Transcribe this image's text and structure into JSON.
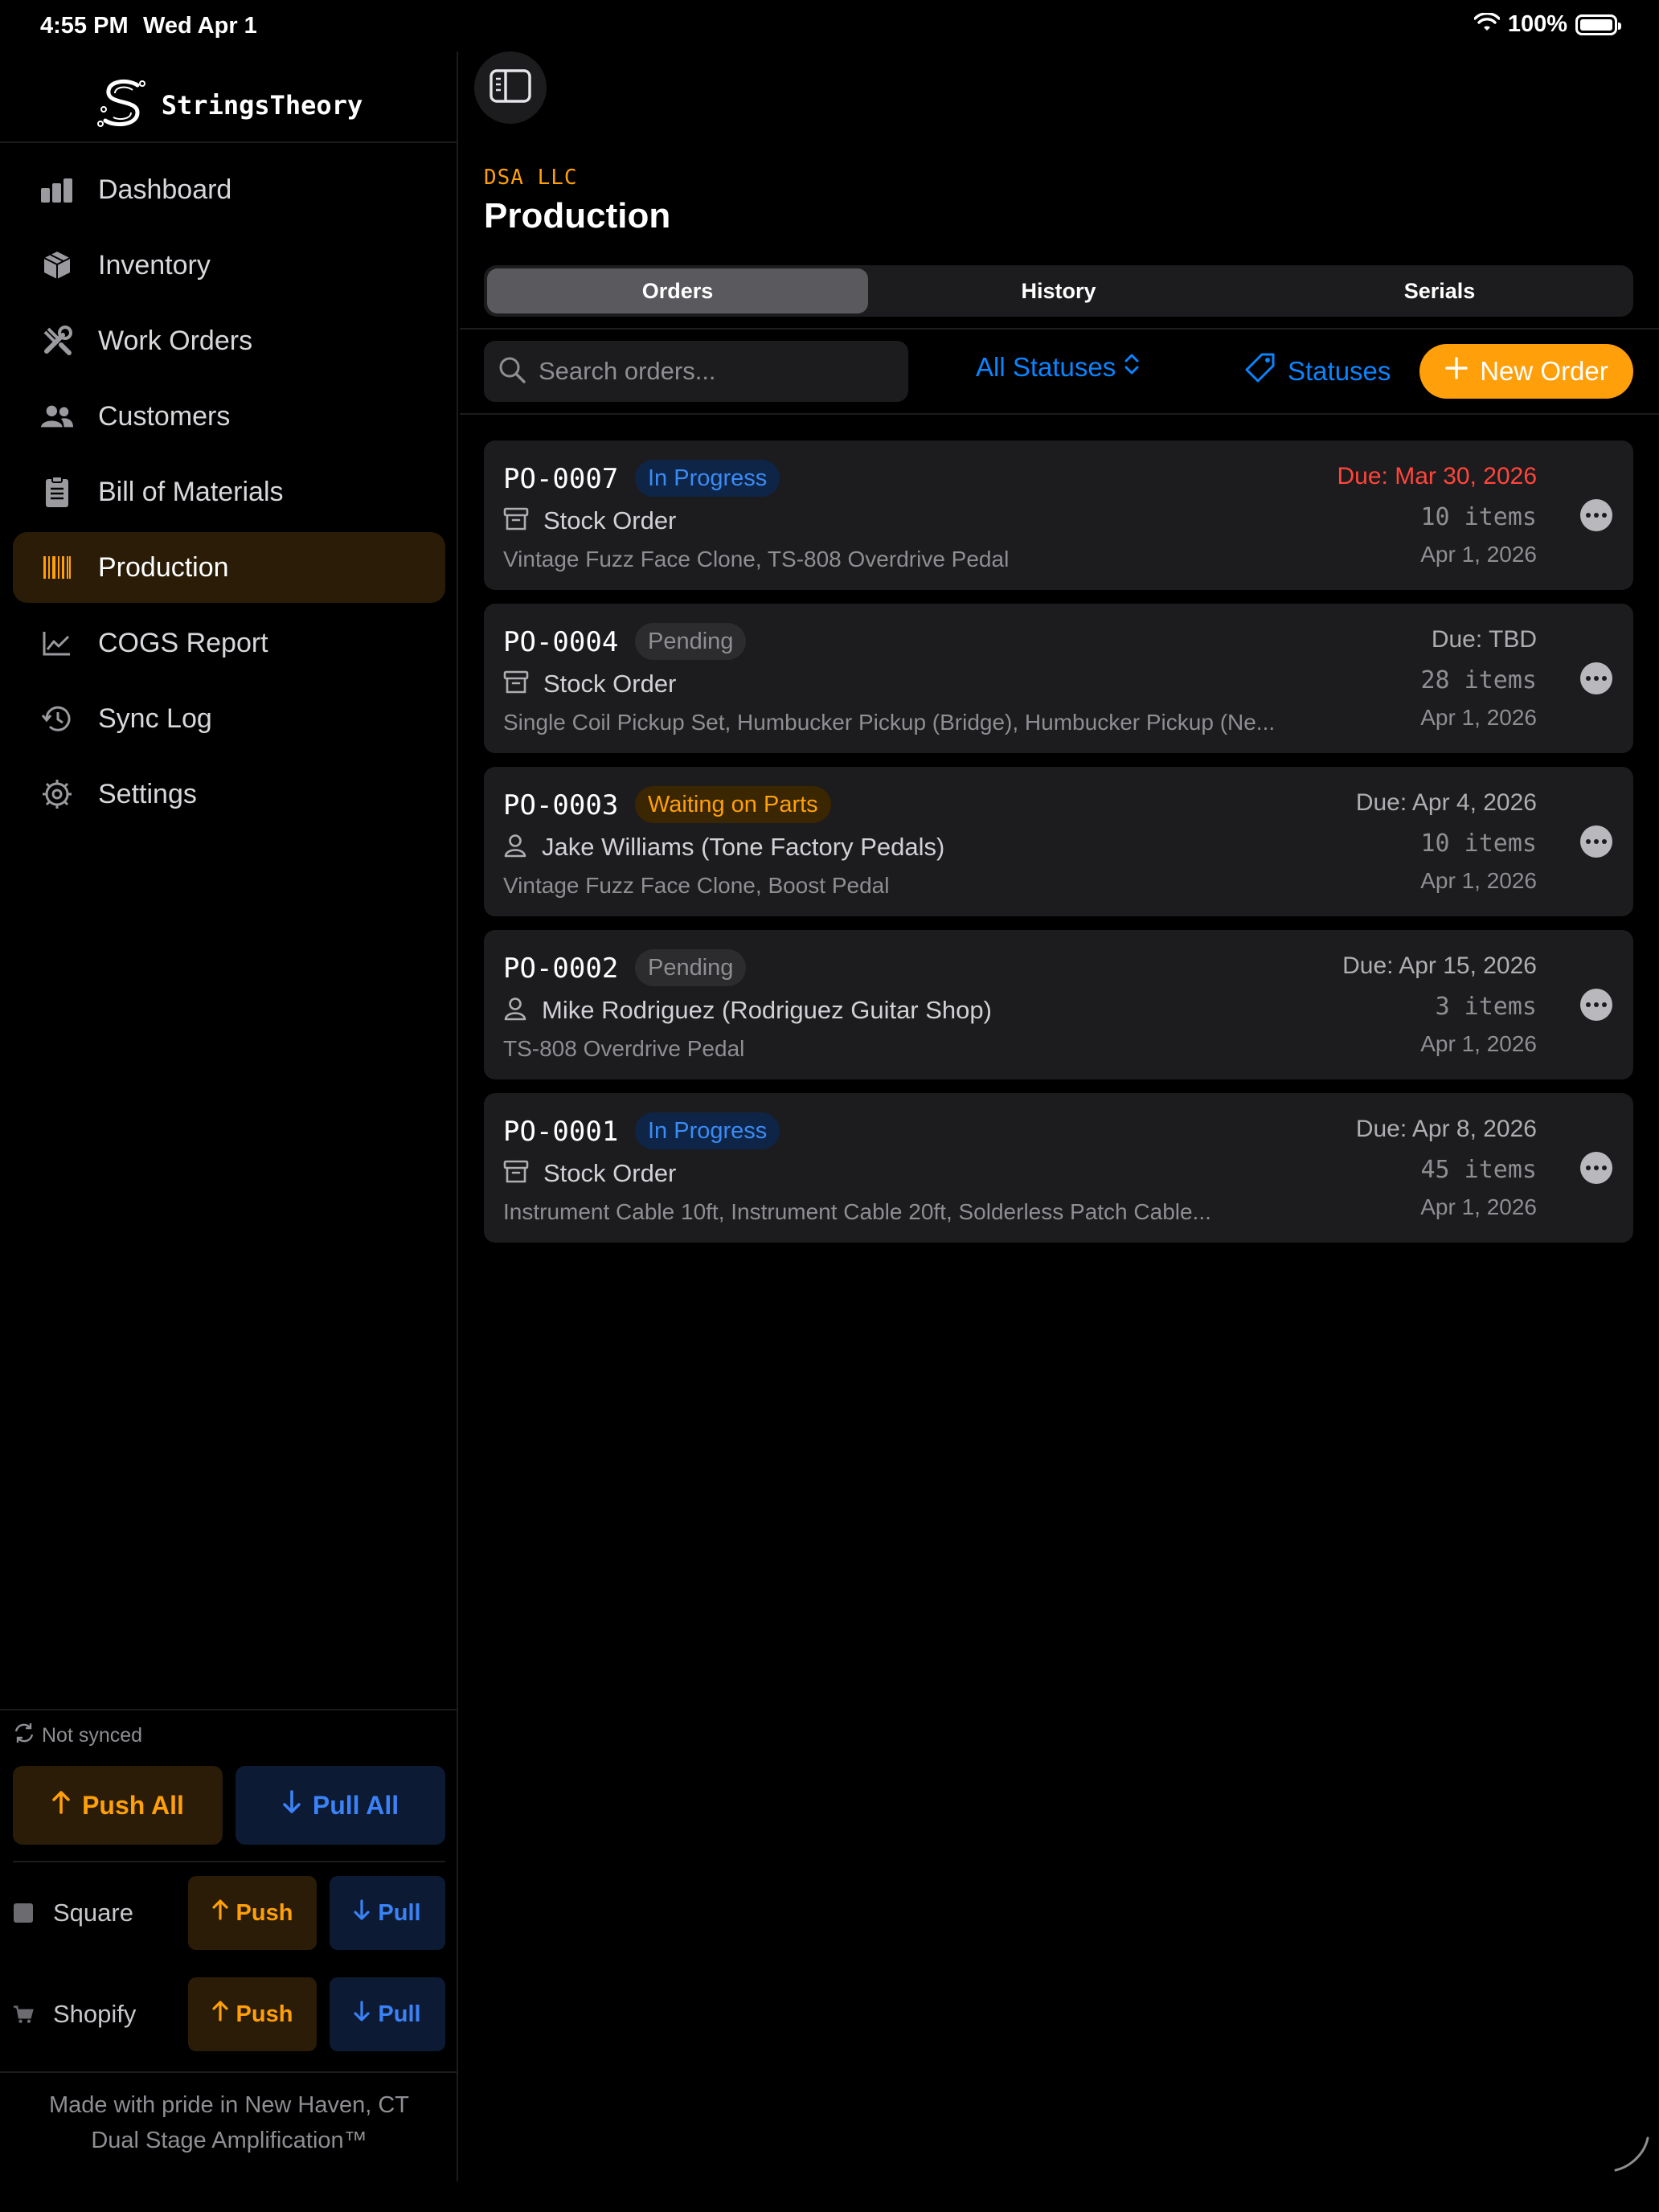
{
  "status_bar": {
    "time": "4:55 PM",
    "date": "Wed Apr 1",
    "battery": "100%"
  },
  "brand": {
    "name": "StringsTheory",
    "icon": "s-logo"
  },
  "nav": [
    {
      "label": "Dashboard",
      "icon": "chart-bars-icon",
      "active": false
    },
    {
      "label": "Inventory",
      "icon": "box-icon",
      "active": false
    },
    {
      "label": "Work Orders",
      "icon": "tools-icon",
      "active": false
    },
    {
      "label": "Customers",
      "icon": "people-icon",
      "active": false
    },
    {
      "label": "Bill of Materials",
      "icon": "clipboard-icon",
      "active": false
    },
    {
      "label": "Production",
      "icon": "barcode-icon",
      "active": true
    },
    {
      "label": "COGS Report",
      "icon": "line-chart-icon",
      "active": false
    },
    {
      "label": "Sync Log",
      "icon": "history-icon",
      "active": false
    },
    {
      "label": "Settings",
      "icon": "gear-icon",
      "active": false
    }
  ],
  "sync": {
    "status": "Not synced",
    "push_all": "Push All",
    "pull_all": "Pull All",
    "services": [
      {
        "name": "Square",
        "push": "Push",
        "pull": "Pull",
        "icon": "square-icon"
      },
      {
        "name": "Shopify",
        "push": "Push",
        "pull": "Pull",
        "icon": "cart-icon"
      }
    ]
  },
  "footer": {
    "line1": "Made with pride in New Haven, CT",
    "line2": "Dual Stage Amplification™"
  },
  "header": {
    "company": "DSA LLC",
    "title": "Production"
  },
  "tabs": [
    {
      "label": "Orders",
      "active": true
    },
    {
      "label": "History",
      "active": false
    },
    {
      "label": "Serials",
      "active": false
    }
  ],
  "toolbar": {
    "search_placeholder": "Search orders...",
    "status_filter": "All Statuses",
    "statuses_label": "Statuses",
    "new_order_label": "New Order"
  },
  "colors": {
    "accent": "#ff9f0a",
    "link": "#0a84ff",
    "overdue": "#ff453a"
  },
  "orders": [
    {
      "id": "PO-0007",
      "status": "In Progress",
      "status_kind": "progress",
      "type_icon": "archive-box-icon",
      "type": "Stock Order",
      "products": "Vintage Fuzz Face Clone, TS-808 Overdrive Pedal",
      "due": "Due: Mar 30, 2026",
      "overdue": true,
      "items": "10 items",
      "date": "Apr 1, 2026"
    },
    {
      "id": "PO-0004",
      "status": "Pending",
      "status_kind": "pending",
      "type_icon": "archive-box-icon",
      "type": "Stock Order",
      "products": "Single Coil Pickup Set, Humbucker Pickup (Bridge), Humbucker Pickup (Ne...",
      "due": "Due: TBD",
      "overdue": false,
      "items": "28 items",
      "date": "Apr 1, 2026"
    },
    {
      "id": "PO-0003",
      "status": "Waiting on Parts",
      "status_kind": "waiting",
      "type_icon": "person-icon",
      "type": "Jake Williams (Tone Factory Pedals)",
      "products": "Vintage Fuzz Face Clone, Boost Pedal",
      "due": "Due: Apr 4, 2026",
      "overdue": false,
      "items": "10 items",
      "date": "Apr 1, 2026"
    },
    {
      "id": "PO-0002",
      "status": "Pending",
      "status_kind": "pending",
      "type_icon": "person-icon",
      "type": "Mike Rodriguez (Rodriguez Guitar Shop)",
      "products": "TS-808 Overdrive Pedal",
      "due": "Due: Apr 15, 2026",
      "overdue": false,
      "items": "3 items",
      "date": "Apr 1, 2026"
    },
    {
      "id": "PO-0001",
      "status": "In Progress",
      "status_kind": "progress",
      "type_icon": "archive-box-icon",
      "type": "Stock Order",
      "products": "Instrument Cable 10ft, Instrument Cable 20ft, Solderless Patch Cable...",
      "due": "Due: Apr 8, 2026",
      "overdue": false,
      "items": "45 items",
      "date": "Apr 1, 2026"
    }
  ]
}
